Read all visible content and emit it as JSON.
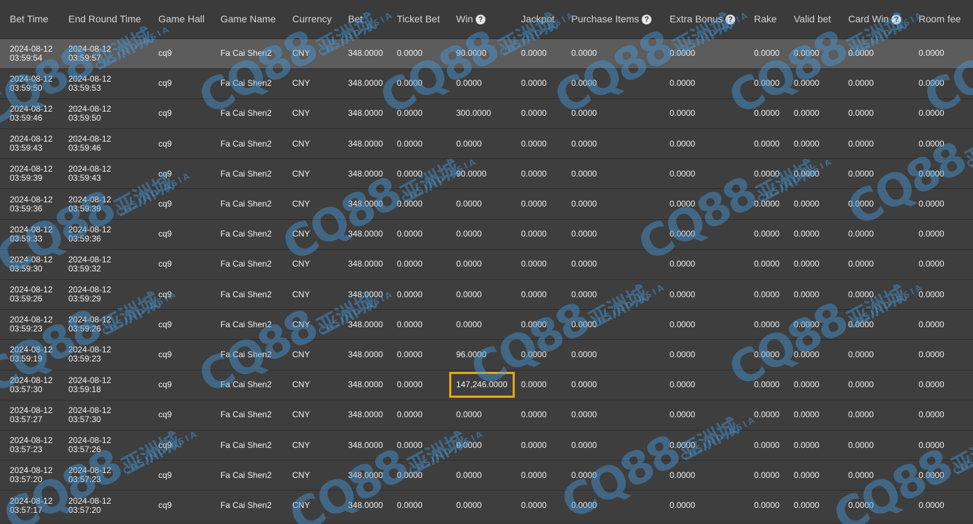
{
  "columns": [
    {
      "label": "Bet Time",
      "help": false
    },
    {
      "label": "End Round Time",
      "help": false
    },
    {
      "label": "Game Hall",
      "help": false
    },
    {
      "label": "Game Name",
      "help": false
    },
    {
      "label": "Currency",
      "help": false
    },
    {
      "label": "Bet",
      "help": false
    },
    {
      "label": "Ticket Bet",
      "help": false
    },
    {
      "label": "Win",
      "help": true
    },
    {
      "label": "Jackpot",
      "help": false
    },
    {
      "label": "Purchase Items",
      "help": true
    },
    {
      "label": "Extra Bonus",
      "help": true
    },
    {
      "label": "Rake",
      "help": false
    },
    {
      "label": "Valid bet",
      "help": false
    },
    {
      "label": "Card Win",
      "help": true
    },
    {
      "label": "Room fee",
      "help": false
    }
  ],
  "help_glyph": "?",
  "highlight_color": "#e8a817",
  "watermark": {
    "logo": "CQ88",
    "chinese": "亚洲城",
    "sub": "CASINO ASIA"
  },
  "rows": [
    {
      "bet_date": "2024-08-12",
      "bet_time": "03:59:54",
      "end_date": "2024-08-12",
      "end_time": "03:59:57",
      "hall": "cq9",
      "game": "Fa Cai Shen2",
      "currency": "CNY",
      "bet": "348.0000",
      "ticket_bet": "0.0000",
      "win": "90.0000",
      "jackpot": "0.0000",
      "purchase": "0.0000",
      "extra_bonus": "0.0000",
      "rake": "0.0000",
      "valid_bet": "0.0000",
      "card_win": "0.0000",
      "room_fee": "0.0000",
      "selected": true
    },
    {
      "bet_date": "2024-08-12",
      "bet_time": "03:59:50",
      "end_date": "2024-08-12",
      "end_time": "03:59:53",
      "hall": "cq9",
      "game": "Fa Cai Shen2",
      "currency": "CNY",
      "bet": "348.0000",
      "ticket_bet": "0.0000",
      "win": "0.0000",
      "jackpot": "0.0000",
      "purchase": "0.0000",
      "extra_bonus": "0.0000",
      "rake": "0.0000",
      "valid_bet": "0.0000",
      "card_win": "0.0000",
      "room_fee": "0.0000"
    },
    {
      "bet_date": "2024-08-12",
      "bet_time": "03:59:46",
      "end_date": "2024-08-12",
      "end_time": "03:59:50",
      "hall": "cq9",
      "game": "Fa Cai Shen2",
      "currency": "CNY",
      "bet": "348.0000",
      "ticket_bet": "0.0000",
      "win": "300.0000",
      "jackpot": "0.0000",
      "purchase": "0.0000",
      "extra_bonus": "0.0000",
      "rake": "0.0000",
      "valid_bet": "0.0000",
      "card_win": "0.0000",
      "room_fee": "0.0000"
    },
    {
      "bet_date": "2024-08-12",
      "bet_time": "03:59:43",
      "end_date": "2024-08-12",
      "end_time": "03:59:46",
      "hall": "cq9",
      "game": "Fa Cai Shen2",
      "currency": "CNY",
      "bet": "348.0000",
      "ticket_bet": "0.0000",
      "win": "0.0000",
      "jackpot": "0.0000",
      "purchase": "0.0000",
      "extra_bonus": "0.0000",
      "rake": "0.0000",
      "valid_bet": "0.0000",
      "card_win": "0.0000",
      "room_fee": "0.0000"
    },
    {
      "bet_date": "2024-08-12",
      "bet_time": "03:59:39",
      "end_date": "2024-08-12",
      "end_time": "03:59:43",
      "hall": "cq9",
      "game": "Fa Cai Shen2",
      "currency": "CNY",
      "bet": "348.0000",
      "ticket_bet": "0.0000",
      "win": "90.0000",
      "jackpot": "0.0000",
      "purchase": "0.0000",
      "extra_bonus": "0.0000",
      "rake": "0.0000",
      "valid_bet": "0.0000",
      "card_win": "0.0000",
      "room_fee": "0.0000"
    },
    {
      "bet_date": "2024-08-12",
      "bet_time": "03:59:36",
      "end_date": "2024-08-12",
      "end_time": "03:59:39",
      "hall": "cq9",
      "game": "Fa Cai Shen2",
      "currency": "CNY",
      "bet": "348.0000",
      "ticket_bet": "0.0000",
      "win": "0.0000",
      "jackpot": "0.0000",
      "purchase": "0.0000",
      "extra_bonus": "0.0000",
      "rake": "0.0000",
      "valid_bet": "0.0000",
      "card_win": "0.0000",
      "room_fee": "0.0000"
    },
    {
      "bet_date": "2024-08-12",
      "bet_time": "03:59:33",
      "end_date": "2024-08-12",
      "end_time": "03:59:36",
      "hall": "cq9",
      "game": "Fa Cai Shen2",
      "currency": "CNY",
      "bet": "348.0000",
      "ticket_bet": "0.0000",
      "win": "0.0000",
      "jackpot": "0.0000",
      "purchase": "0.0000",
      "extra_bonus": "0.0000",
      "rake": "0.0000",
      "valid_bet": "0.0000",
      "card_win": "0.0000",
      "room_fee": "0.0000"
    },
    {
      "bet_date": "2024-08-12",
      "bet_time": "03:59:30",
      "end_date": "2024-08-12",
      "end_time": "03:59:32",
      "hall": "cq9",
      "game": "Fa Cai Shen2",
      "currency": "CNY",
      "bet": "348.0000",
      "ticket_bet": "0.0000",
      "win": "0.0000",
      "jackpot": "0.0000",
      "purchase": "0.0000",
      "extra_bonus": "0.0000",
      "rake": "0.0000",
      "valid_bet": "0.0000",
      "card_win": "0.0000",
      "room_fee": "0.0000"
    },
    {
      "bet_date": "2024-08-12",
      "bet_time": "03:59:26",
      "end_date": "2024-08-12",
      "end_time": "03:59:29",
      "hall": "cq9",
      "game": "Fa Cai Shen2",
      "currency": "CNY",
      "bet": "348.0000",
      "ticket_bet": "0.0000",
      "win": "0.0000",
      "jackpot": "0.0000",
      "purchase": "0.0000",
      "extra_bonus": "0.0000",
      "rake": "0.0000",
      "valid_bet": "0.0000",
      "card_win": "0.0000",
      "room_fee": "0.0000"
    },
    {
      "bet_date": "2024-08-12",
      "bet_time": "03:59:23",
      "end_date": "2024-08-12",
      "end_time": "03:59:26",
      "hall": "cq9",
      "game": "Fa Cai Shen2",
      "currency": "CNY",
      "bet": "348.0000",
      "ticket_bet": "0.0000",
      "win": "0.0000",
      "jackpot": "0.0000",
      "purchase": "0.0000",
      "extra_bonus": "0.0000",
      "rake": "0.0000",
      "valid_bet": "0.0000",
      "card_win": "0.0000",
      "room_fee": "0.0000"
    },
    {
      "bet_date": "2024-08-12",
      "bet_time": "03:59:19",
      "end_date": "2024-08-12",
      "end_time": "03:59:23",
      "hall": "cq9",
      "game": "Fa Cai Shen2",
      "currency": "CNY",
      "bet": "348.0000",
      "ticket_bet": "0.0000",
      "win": "96.0000",
      "jackpot": "0.0000",
      "purchase": "0.0000",
      "extra_bonus": "0.0000",
      "rake": "0.0000",
      "valid_bet": "0.0000",
      "card_win": "0.0000",
      "room_fee": "0.0000"
    },
    {
      "bet_date": "2024-08-12",
      "bet_time": "03:57:30",
      "end_date": "2024-08-12",
      "end_time": "03:59:18",
      "hall": "cq9",
      "game": "Fa Cai Shen2",
      "currency": "CNY",
      "bet": "348.0000",
      "ticket_bet": "0.0000",
      "win": "147,246.0000",
      "jackpot": "0.0000",
      "purchase": "0.0000",
      "extra_bonus": "0.0000",
      "rake": "0.0000",
      "valid_bet": "0.0000",
      "card_win": "0.0000",
      "room_fee": "0.0000",
      "highlight_win": true
    },
    {
      "bet_date": "2024-08-12",
      "bet_time": "03:57:27",
      "end_date": "2024-08-12",
      "end_time": "03:57:30",
      "hall": "cq9",
      "game": "Fa Cai Shen2",
      "currency": "CNY",
      "bet": "348.0000",
      "ticket_bet": "0.0000",
      "win": "0.0000",
      "jackpot": "0.0000",
      "purchase": "0.0000",
      "extra_bonus": "0.0000",
      "rake": "0.0000",
      "valid_bet": "0.0000",
      "card_win": "0.0000",
      "room_fee": "0.0000"
    },
    {
      "bet_date": "2024-08-12",
      "bet_time": "03:57:23",
      "end_date": "2024-08-12",
      "end_time": "03:57:26",
      "hall": "cq9",
      "game": "Fa Cai Shen2",
      "currency": "CNY",
      "bet": "348.0000",
      "ticket_bet": "0.0000",
      "win": "0.0000",
      "jackpot": "0.0000",
      "purchase": "0.0000",
      "extra_bonus": "0.0000",
      "rake": "0.0000",
      "valid_bet": "0.0000",
      "card_win": "0.0000",
      "room_fee": "0.0000"
    },
    {
      "bet_date": "2024-08-12",
      "bet_time": "03:57:20",
      "end_date": "2024-08-12",
      "end_time": "03:57:23",
      "hall": "cq9",
      "game": "Fa Cai Shen2",
      "currency": "CNY",
      "bet": "348.0000",
      "ticket_bet": "0.0000",
      "win": "0.0000",
      "jackpot": "0.0000",
      "purchase": "0.0000",
      "extra_bonus": "0.0000",
      "rake": "0.0000",
      "valid_bet": "0.0000",
      "card_win": "0.0000",
      "room_fee": "0.0000"
    },
    {
      "bet_date": "2024-08-12",
      "bet_time": "03:57:17",
      "end_date": "2024-08-12",
      "end_time": "03:57:20",
      "hall": "cq9",
      "game": "Fa Cai Shen2",
      "currency": "CNY",
      "bet": "348.0000",
      "ticket_bet": "0.0000",
      "win": "0.0000",
      "jackpot": "0.0000",
      "purchase": "0.0000",
      "extra_bonus": "0.0000",
      "rake": "0.0000",
      "valid_bet": "0.0000",
      "card_win": "0.0000",
      "room_fee": "0.0000"
    }
  ]
}
